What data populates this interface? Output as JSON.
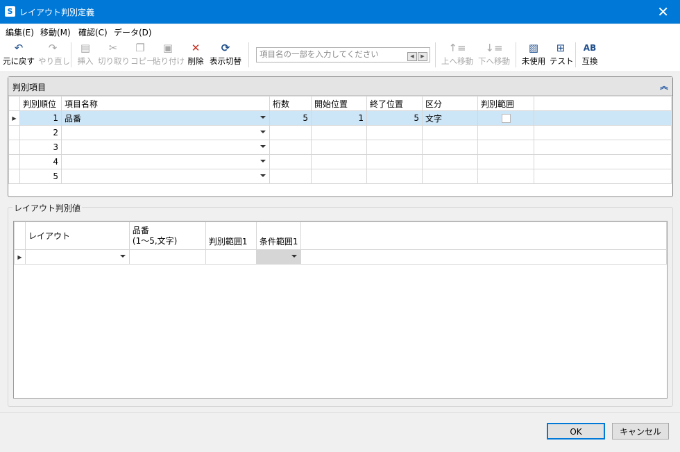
{
  "window": {
    "title": "レイアウト判別定義",
    "app_icon": "S"
  },
  "menu": [
    {
      "label": "編集(E)"
    },
    {
      "label": "移動(M)"
    },
    {
      "label": "確認(C)"
    },
    {
      "label": "データ(D)"
    }
  ],
  "toolbar": {
    "undo": "元に戻す",
    "redo": "やり直し",
    "insert": "挿入",
    "cut": "切り取り",
    "copy": "コピー",
    "paste": "貼り付け",
    "delete": "削除",
    "toggle_display": "表示切替",
    "search_placeholder": "項目名の一部を入力してください",
    "move_up": "上へ移動",
    "move_down": "下へ移動",
    "unused": "未使用",
    "test": "テスト",
    "swap": "互換"
  },
  "panel1": {
    "title": "判別項目",
    "columns": [
      "判別順位",
      "項目名称",
      "桁数",
      "開始位置",
      "終了位置",
      "区分",
      "判別範囲"
    ],
    "rows": [
      {
        "order": "1",
        "name": "品番",
        "digits": "5",
        "start": "1",
        "end": "5",
        "kind": "文字"
      },
      {
        "order": "2",
        "name": "",
        "digits": "",
        "start": "",
        "end": "",
        "kind": ""
      },
      {
        "order": "3",
        "name": "",
        "digits": "",
        "start": "",
        "end": "",
        "kind": ""
      },
      {
        "order": "4",
        "name": "",
        "digits": "",
        "start": "",
        "end": "",
        "kind": ""
      },
      {
        "order": "5",
        "name": "",
        "digits": "",
        "start": "",
        "end": "",
        "kind": ""
      }
    ]
  },
  "panel2": {
    "title": "レイアウト判別値",
    "columns": {
      "layout": "レイアウト",
      "hinban_line1": "品番",
      "hinban_line2": "(1～5,文字)",
      "range1": "判別範囲1",
      "cond1": "条件範囲1"
    }
  },
  "buttons": {
    "ok": "OK",
    "cancel": "キャンセル"
  },
  "colors": {
    "titlebar": "#0078d7",
    "selected_row": "#cde6f7",
    "delete_icon": "#c42b1c"
  }
}
